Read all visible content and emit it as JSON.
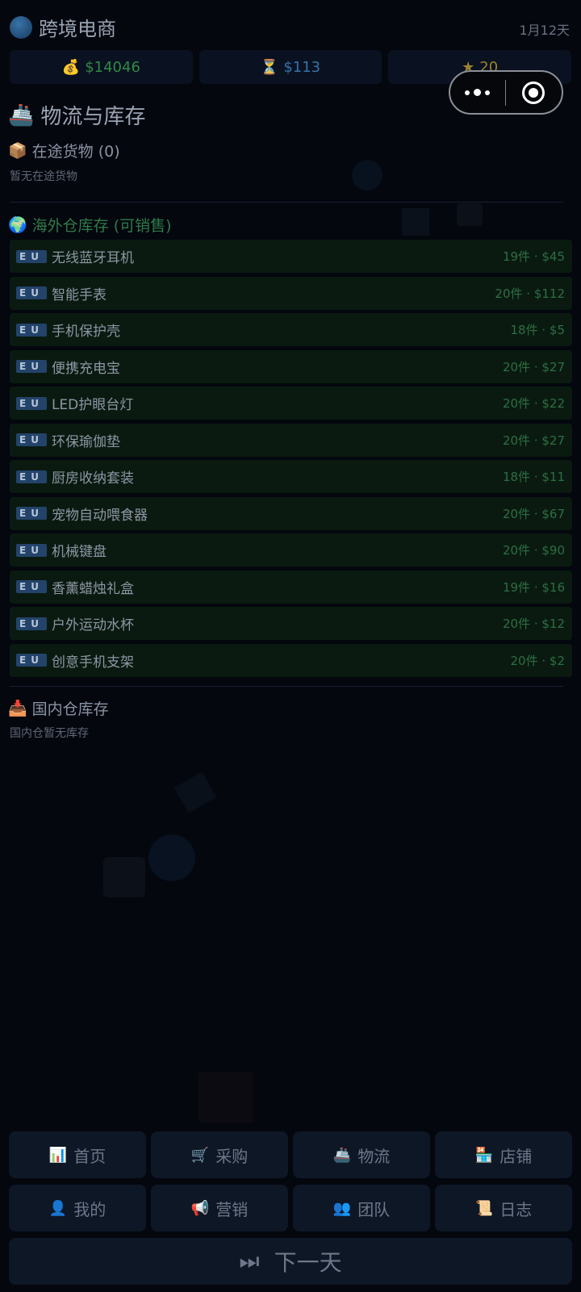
{
  "header": {
    "title": "跨境电商",
    "globe_icon": "globe-icon",
    "day": "1月12天"
  },
  "stats": {
    "money": "$14046",
    "time_value": "$113",
    "score": "20"
  },
  "section": {
    "title": "物流与库存",
    "icon": "ship-icon"
  },
  "in_transit": {
    "heading": "在途货物 (0)",
    "empty": "暂无在途货物"
  },
  "overseas": {
    "heading": "海外仓库存 (可销售)",
    "items": [
      {
        "region": "EU",
        "name": "无线蓝牙耳机",
        "qty": "19件",
        "price": "$45"
      },
      {
        "region": "EU",
        "name": "智能手表",
        "qty": "20件",
        "price": "$112"
      },
      {
        "region": "EU",
        "name": "手机保护壳",
        "qty": "18件",
        "price": "$5"
      },
      {
        "region": "EU",
        "name": "便携充电宝",
        "qty": "20件",
        "price": "$27"
      },
      {
        "region": "EU",
        "name": "LED护眼台灯",
        "qty": "20件",
        "price": "$22"
      },
      {
        "region": "EU",
        "name": "环保瑜伽垫",
        "qty": "20件",
        "price": "$27"
      },
      {
        "region": "EU",
        "name": "厨房收纳套装",
        "qty": "18件",
        "price": "$11"
      },
      {
        "region": "EU",
        "name": "宠物自动喂食器",
        "qty": "20件",
        "price": "$67"
      },
      {
        "region": "EU",
        "name": "机械键盘",
        "qty": "20件",
        "price": "$90"
      },
      {
        "region": "EU",
        "name": "香薰蜡烛礼盒",
        "qty": "19件",
        "price": "$16"
      },
      {
        "region": "EU",
        "name": "户外运动水杯",
        "qty": "20件",
        "price": "$12"
      },
      {
        "region": "EU",
        "name": "创意手机支架",
        "qty": "20件",
        "price": "$2"
      }
    ]
  },
  "domestic": {
    "heading": "国内仓库存",
    "empty": "国内仓暂无库存"
  },
  "nav": {
    "home": "首页",
    "purchase": "采购",
    "logistics": "物流",
    "shop": "店铺",
    "me": "我的",
    "marketing": "营销",
    "team": "团队",
    "log": "日志",
    "next_day": "下一天"
  },
  "colors": {
    "background": "#04070e",
    "accent_green": "#2f7a4a",
    "money_green": "#2f8a45",
    "card_bg": "#0e1726"
  }
}
